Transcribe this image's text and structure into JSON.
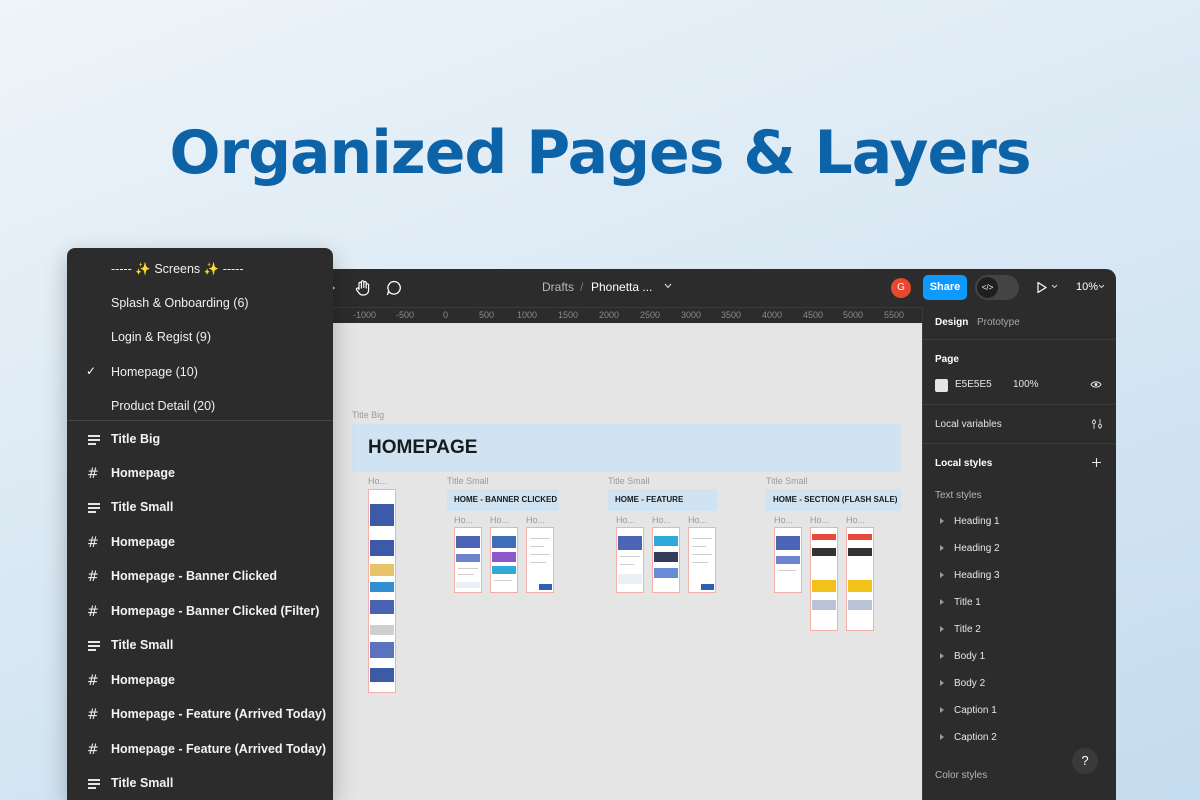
{
  "headline": "Organized Pages & Layers",
  "topbar": {
    "breadcrumb_drafts": "Drafts",
    "breadcrumb_sep": "/",
    "file_name": "Phonetta ...",
    "avatar_initial": "G",
    "share_label": "Share",
    "dev_mode_glyph": "</>",
    "zoom": "10%",
    "icons": [
      "hand-tool-icon",
      "comment-icon",
      "chevron-down-icon",
      "play-icon"
    ],
    "colors": {
      "bar": "#2c2c2c",
      "share": "#0d99ff",
      "avatar": "#e8482d"
    }
  },
  "ruler_ticks": [
    "-1000",
    "-500",
    "0",
    "500",
    "1000",
    "1500",
    "2000",
    "2500",
    "3000",
    "3500",
    "4000",
    "4500",
    "5000",
    "5500"
  ],
  "canvas": {
    "title_big_label": "Title Big",
    "title_big_text": "HOMEPAGE",
    "col1_label": "Ho...",
    "sections": [
      {
        "label": "Title Small",
        "title": "HOME - BANNER CLICKED",
        "screens": [
          "Ho...",
          "Ho...",
          "Ho..."
        ]
      },
      {
        "label": "Title Small",
        "title": "HOME - FEATURE",
        "screens": [
          "Ho...",
          "Ho...",
          "Ho..."
        ]
      },
      {
        "label": "Title Small",
        "title": "HOME - SECTION (FLASH SALE)",
        "screens": [
          "Ho...",
          "Ho...",
          "Ho..."
        ]
      }
    ],
    "colors": {
      "title_box": "#cfe3f3",
      "canvas": "#e5e5e5"
    }
  },
  "panel": {
    "tab_design": "Design",
    "tab_prototype": "Prototype",
    "page_heading": "Page",
    "page_color": "E5E5E5",
    "page_opacity": "100%",
    "local_variables": "Local variables",
    "local_styles": "Local styles",
    "text_styles": "Text styles",
    "styles": [
      "Heading 1",
      "Heading 2",
      "Heading 3",
      "Title 1",
      "Title 2",
      "Body 1",
      "Body 2",
      "Caption 1",
      "Caption 2"
    ],
    "color_styles": "Color styles",
    "help": "?",
    "icons": [
      "eye-icon",
      "variables-icon",
      "plus-icon",
      "help-icon"
    ]
  },
  "layers": {
    "pages": [
      {
        "label": "----- ✨ Screens ✨ -----",
        "selected": false
      },
      {
        "label": "Splash & Onboarding (6)",
        "selected": false
      },
      {
        "label": "Login & Regist (9)",
        "selected": false
      },
      {
        "label": "Homepage (10)",
        "selected": true
      },
      {
        "label": "Product Detail (20)",
        "selected": false
      }
    ],
    "items": [
      {
        "label": "Title Big",
        "icon": "text-icon"
      },
      {
        "label": "Homepage",
        "icon": "frame-icon"
      },
      {
        "label": "Title Small",
        "icon": "text-icon"
      },
      {
        "label": "Homepage",
        "icon": "frame-icon"
      },
      {
        "label": "Homepage - Banner Clicked",
        "icon": "frame-icon"
      },
      {
        "label": "Homepage - Banner Clicked (Filter)",
        "icon": "frame-icon"
      },
      {
        "label": "Title Small",
        "icon": "text-icon"
      },
      {
        "label": "Homepage",
        "icon": "frame-icon"
      },
      {
        "label": "Homepage - Feature (Arrived Today)",
        "icon": "frame-icon"
      },
      {
        "label": "Homepage - Feature (Arrived Today)",
        "icon": "frame-icon"
      },
      {
        "label": "Title Small",
        "icon": "text-icon"
      }
    ],
    "glyphs": {
      "check": "✓",
      "frame": "#"
    }
  }
}
